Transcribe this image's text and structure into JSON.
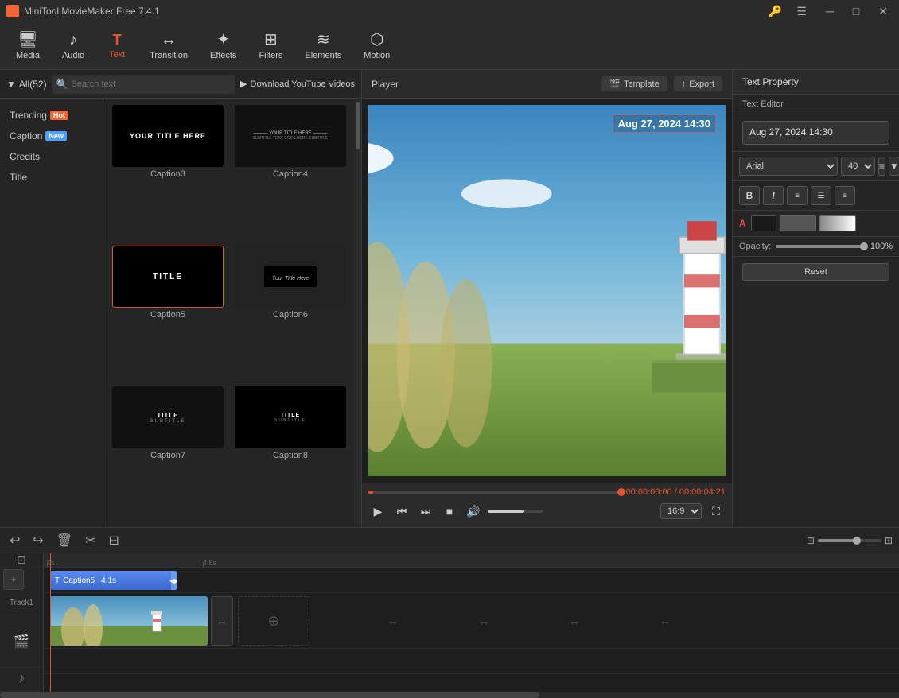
{
  "app": {
    "title": "MiniTool MovieMaker Free 7.4.1"
  },
  "titlebar": {
    "title": "MiniTool MovieMaker Free 7.4.1",
    "min_label": "─",
    "max_label": "□",
    "close_label": "✕"
  },
  "toolbar": {
    "items": [
      {
        "id": "media",
        "label": "Media",
        "icon": "🖥"
      },
      {
        "id": "audio",
        "label": "Audio",
        "icon": "🎵"
      },
      {
        "id": "text",
        "label": "Text",
        "icon": "T",
        "active": true
      },
      {
        "id": "transition",
        "label": "Transition",
        "icon": "↔"
      },
      {
        "id": "effects",
        "label": "Effects",
        "icon": "✦"
      },
      {
        "id": "filters",
        "label": "Filters",
        "icon": "⊞"
      },
      {
        "id": "elements",
        "label": "Elements",
        "icon": "≋"
      },
      {
        "id": "motion",
        "label": "Motion",
        "icon": "⬡"
      }
    ]
  },
  "left_panel": {
    "all_label": "All(52)",
    "search_placeholder": "Search text",
    "yt_label": "Download YouTube Videos",
    "categories": [
      {
        "id": "trending",
        "label": "Trending",
        "badge": "Hot",
        "badge_type": "hot"
      },
      {
        "id": "caption",
        "label": "Caption",
        "badge": "New",
        "badge_type": "new"
      },
      {
        "id": "credits",
        "label": "Credits",
        "badge": null
      },
      {
        "id": "title",
        "label": "Title",
        "badge": null
      }
    ],
    "templates": [
      {
        "id": "caption3",
        "label": "Caption3",
        "selected": false
      },
      {
        "id": "caption4",
        "label": "Caption4",
        "selected": false
      },
      {
        "id": "caption5",
        "label": "Caption5",
        "selected": true
      },
      {
        "id": "caption6",
        "label": "Caption6",
        "selected": false
      },
      {
        "id": "caption7",
        "label": "Caption7",
        "selected": false
      },
      {
        "id": "caption8",
        "label": "Caption8",
        "selected": false
      }
    ]
  },
  "player": {
    "title": "Player",
    "template_btn": "Template",
    "export_btn": "Export",
    "time_current": "00:00:00:00",
    "time_total": "00:00:04:21",
    "text_overlay": "Aug 27, 2024  14:30",
    "aspect_ratio": "16:9"
  },
  "right_panel": {
    "title": "Text Property",
    "editor_label": "Text Editor",
    "text_value": "Aug 27, 2024  14:30",
    "font": "Arial",
    "size": "40",
    "opacity_label": "Opacity:",
    "opacity_value": "100%",
    "reset_label": "Reset"
  },
  "timeline": {
    "track1_label": "Track1",
    "caption_label": "Caption5",
    "caption_duration": "4.1s",
    "time_marker": "4.8s",
    "start_time": "0s"
  }
}
